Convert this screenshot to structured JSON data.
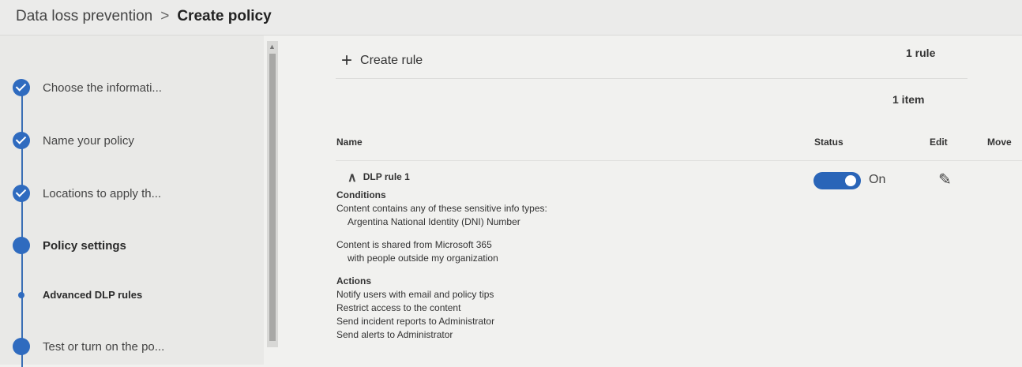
{
  "breadcrumb": {
    "parent": "Data loss prevention",
    "separator": ">",
    "current": "Create policy"
  },
  "steps": [
    {
      "label": "Choose the informati...",
      "state": "done"
    },
    {
      "label": "Name your policy",
      "state": "done"
    },
    {
      "label": "Locations to apply th...",
      "state": "done"
    },
    {
      "label": "Policy settings",
      "state": "current"
    },
    {
      "label": "Advanced DLP rules",
      "state": "current-sub"
    },
    {
      "label": "Test or turn on the po...",
      "state": "upcoming"
    }
  ],
  "toolbar": {
    "create_rule_label": "Create rule",
    "rule_count": "1 rule"
  },
  "list": {
    "item_count": "1 item",
    "columns": [
      "Name",
      "Status",
      "Edit",
      "Move"
    ]
  },
  "rule": {
    "name": "DLP rule 1",
    "status_label": "On",
    "status_on": true,
    "conditions_heading": "Conditions",
    "condition1": "Content contains any of these sensitive info types:",
    "condition1_value": "Argentina National Identity (DNI) Number",
    "condition2": "Content is shared from Microsoft 365",
    "condition2_value": "with people outside my organization",
    "actions_heading": "Actions",
    "actions": [
      "Notify users with email and policy tips",
      "Restrict access to the content",
      "Send incident reports to Administrator",
      "Send alerts to Administrator"
    ]
  },
  "colors": {
    "accent": "#2f6bbf",
    "toggle": "#2a65b8",
    "background": "#f1f1ef"
  },
  "icons": {
    "step_done": "check-circle-icon",
    "create": "plus-icon",
    "expand": "chevron-up-icon",
    "edit": "pencil-icon"
  }
}
